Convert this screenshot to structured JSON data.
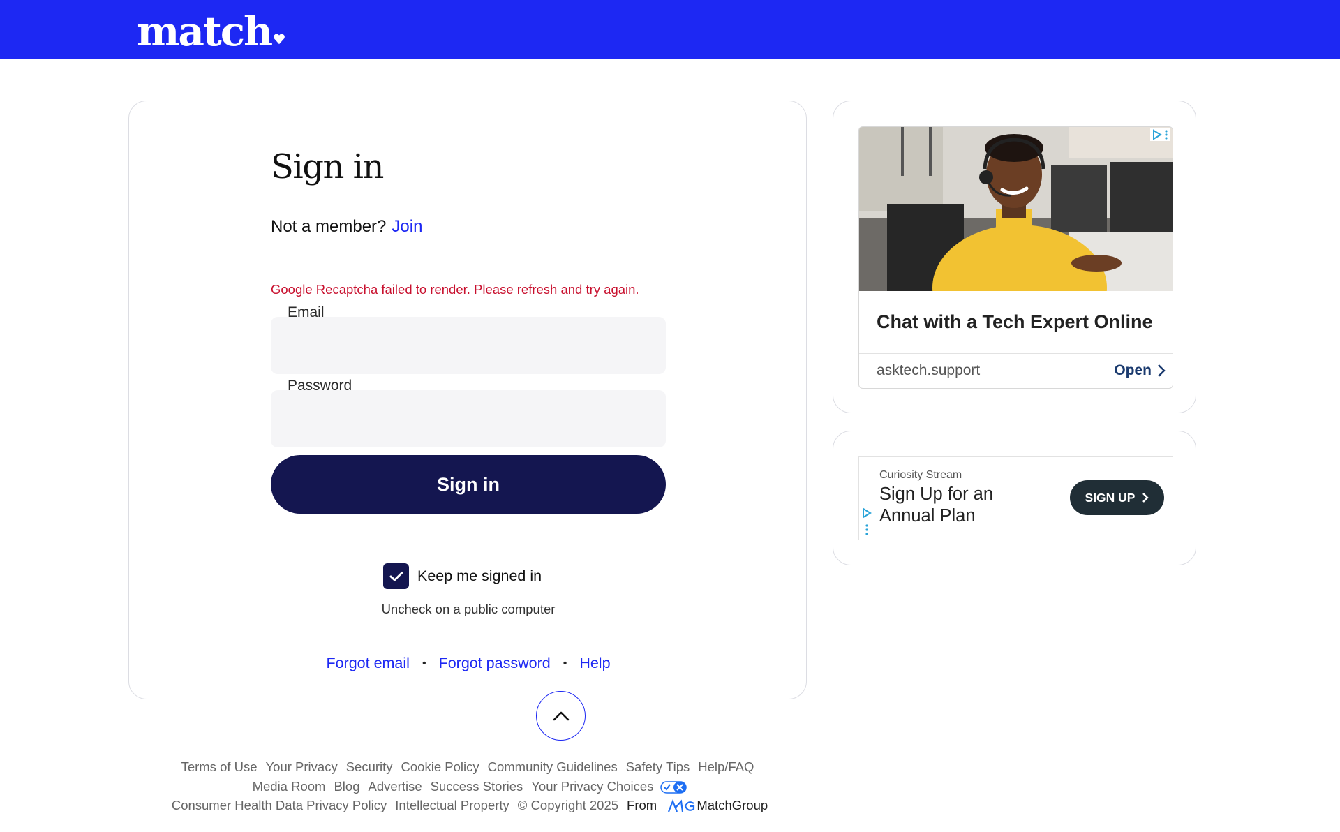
{
  "header": {
    "logo_text": "match",
    "brand_color": "#1d28f3"
  },
  "signin": {
    "title": "Sign in",
    "not_member": "Not a member?",
    "join_label": "Join",
    "error_message": "Google Recaptcha failed to render. Please refresh and try again.",
    "email_label": "Email",
    "email_value": "",
    "password_label": "Password",
    "password_value": "",
    "submit_label": "Sign in",
    "keep_signed_in_label": "Keep me signed in",
    "keep_signed_in_checked": true,
    "uncheck_hint": "Uncheck on a public computer",
    "forgot_email": "Forgot email",
    "forgot_password": "Forgot password",
    "help": "Help",
    "separator": "•",
    "button_color": "#141650",
    "error_color": "#c8102e"
  },
  "scroll_top": {
    "icon": "chevron-up-icon"
  },
  "ads": {
    "ad1": {
      "title": "Chat with a Tech Expert Online",
      "domain": "asktech.support",
      "cta": "Open",
      "image_icon": "tech-support-agent-photo"
    },
    "ad2": {
      "brand": "Curiosity Stream",
      "title": "Sign Up for an Annual Plan",
      "cta": "SIGN UP"
    }
  },
  "footer": {
    "row1": [
      "Terms of Use",
      "Your Privacy",
      "Security",
      "Cookie Policy",
      "Community Guidelines",
      "Safety Tips",
      "Help/FAQ"
    ],
    "row2": [
      "Media Room",
      "Blog",
      "Advertise",
      "Success Stories",
      "Your Privacy Choices"
    ],
    "row3": [
      "Consumer Health Data Privacy Policy",
      "Intellectual Property",
      "© Copyright 2025"
    ],
    "from_label": "From",
    "company": "MatchGroup"
  }
}
